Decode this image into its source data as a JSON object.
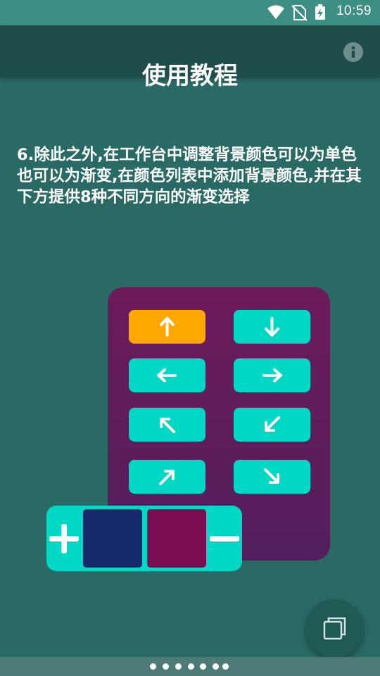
{
  "status_bar": {
    "time": "10:59",
    "icons": [
      "wifi-icon",
      "no-sim-icon",
      "battery-charging-icon"
    ]
  },
  "header": {
    "title": "使用教程",
    "info_icon": "info-icon"
  },
  "tutorial": {
    "description": "6.除此之外,在工作台中调整背景颜色可以为单色也可以为渐变,在颜色列表中添加背景颜色,并在其下方提供8种不同方向的渐变选择"
  },
  "illustration": {
    "direction_buttons": [
      {
        "icon": "arrow-up-icon",
        "glyph": "↑",
        "selected": true
      },
      {
        "icon": "arrow-down-icon",
        "glyph": "↓",
        "selected": false
      },
      {
        "icon": "arrow-left-icon",
        "glyph": "←",
        "selected": false
      },
      {
        "icon": "arrow-right-icon",
        "glyph": "→",
        "selected": false
      },
      {
        "icon": "arrow-up-left-icon",
        "glyph": "↖",
        "selected": false
      },
      {
        "icon": "arrow-down-left-icon",
        "glyph": "↙",
        "selected": false
      },
      {
        "icon": "arrow-up-right-icon",
        "glyph": "↗",
        "selected": false
      },
      {
        "icon": "arrow-down-right-icon",
        "glyph": "↘",
        "selected": false
      }
    ],
    "color_list": {
      "add_icon": "plus-icon",
      "remove_icon": "minus-icon",
      "swatches": [
        "#172a6b",
        "#7a0c52"
      ]
    },
    "colors": {
      "panel_top": "#6c1a5a",
      "panel_bottom": "#521e5c",
      "button": "#00d8c6",
      "button_selected": "#ffa800"
    }
  },
  "fab": {
    "icon": "layers-icon"
  },
  "pager": {
    "count": 7,
    "current": 7
  }
}
